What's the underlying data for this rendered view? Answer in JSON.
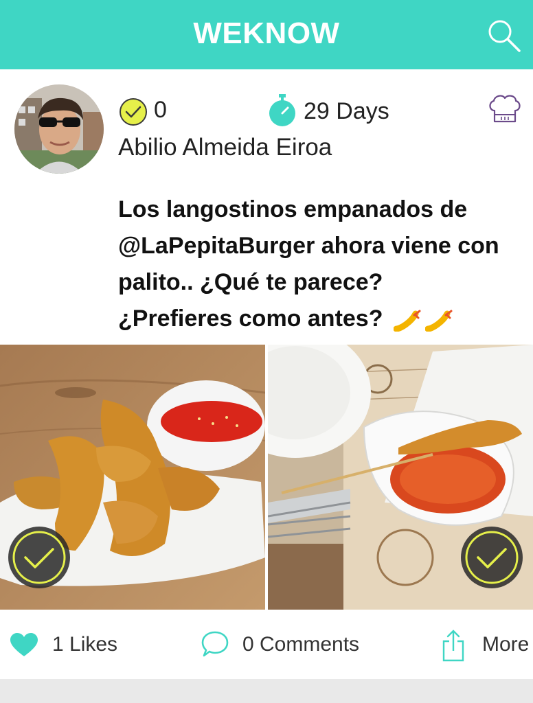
{
  "header": {
    "title": "WEKNOW",
    "search_icon": "search-icon"
  },
  "post": {
    "checks": "0",
    "days": "29 Days",
    "username": "Abilio Almeida Eiroa",
    "text": "Los langostinos empanados de @LaPepitaBurger ahora viene con palito.. ¿Qué te parece? ¿Prefieres como antes?",
    "emoji": "fried-shrimp-emoji"
  },
  "actions": {
    "likes": "1 Likes",
    "comments": "0 Comments",
    "more": "More"
  },
  "colors": {
    "accent": "#3fd6c4",
    "check_yellow": "#e6f04a",
    "chef_purple": "#6b4a8a"
  }
}
